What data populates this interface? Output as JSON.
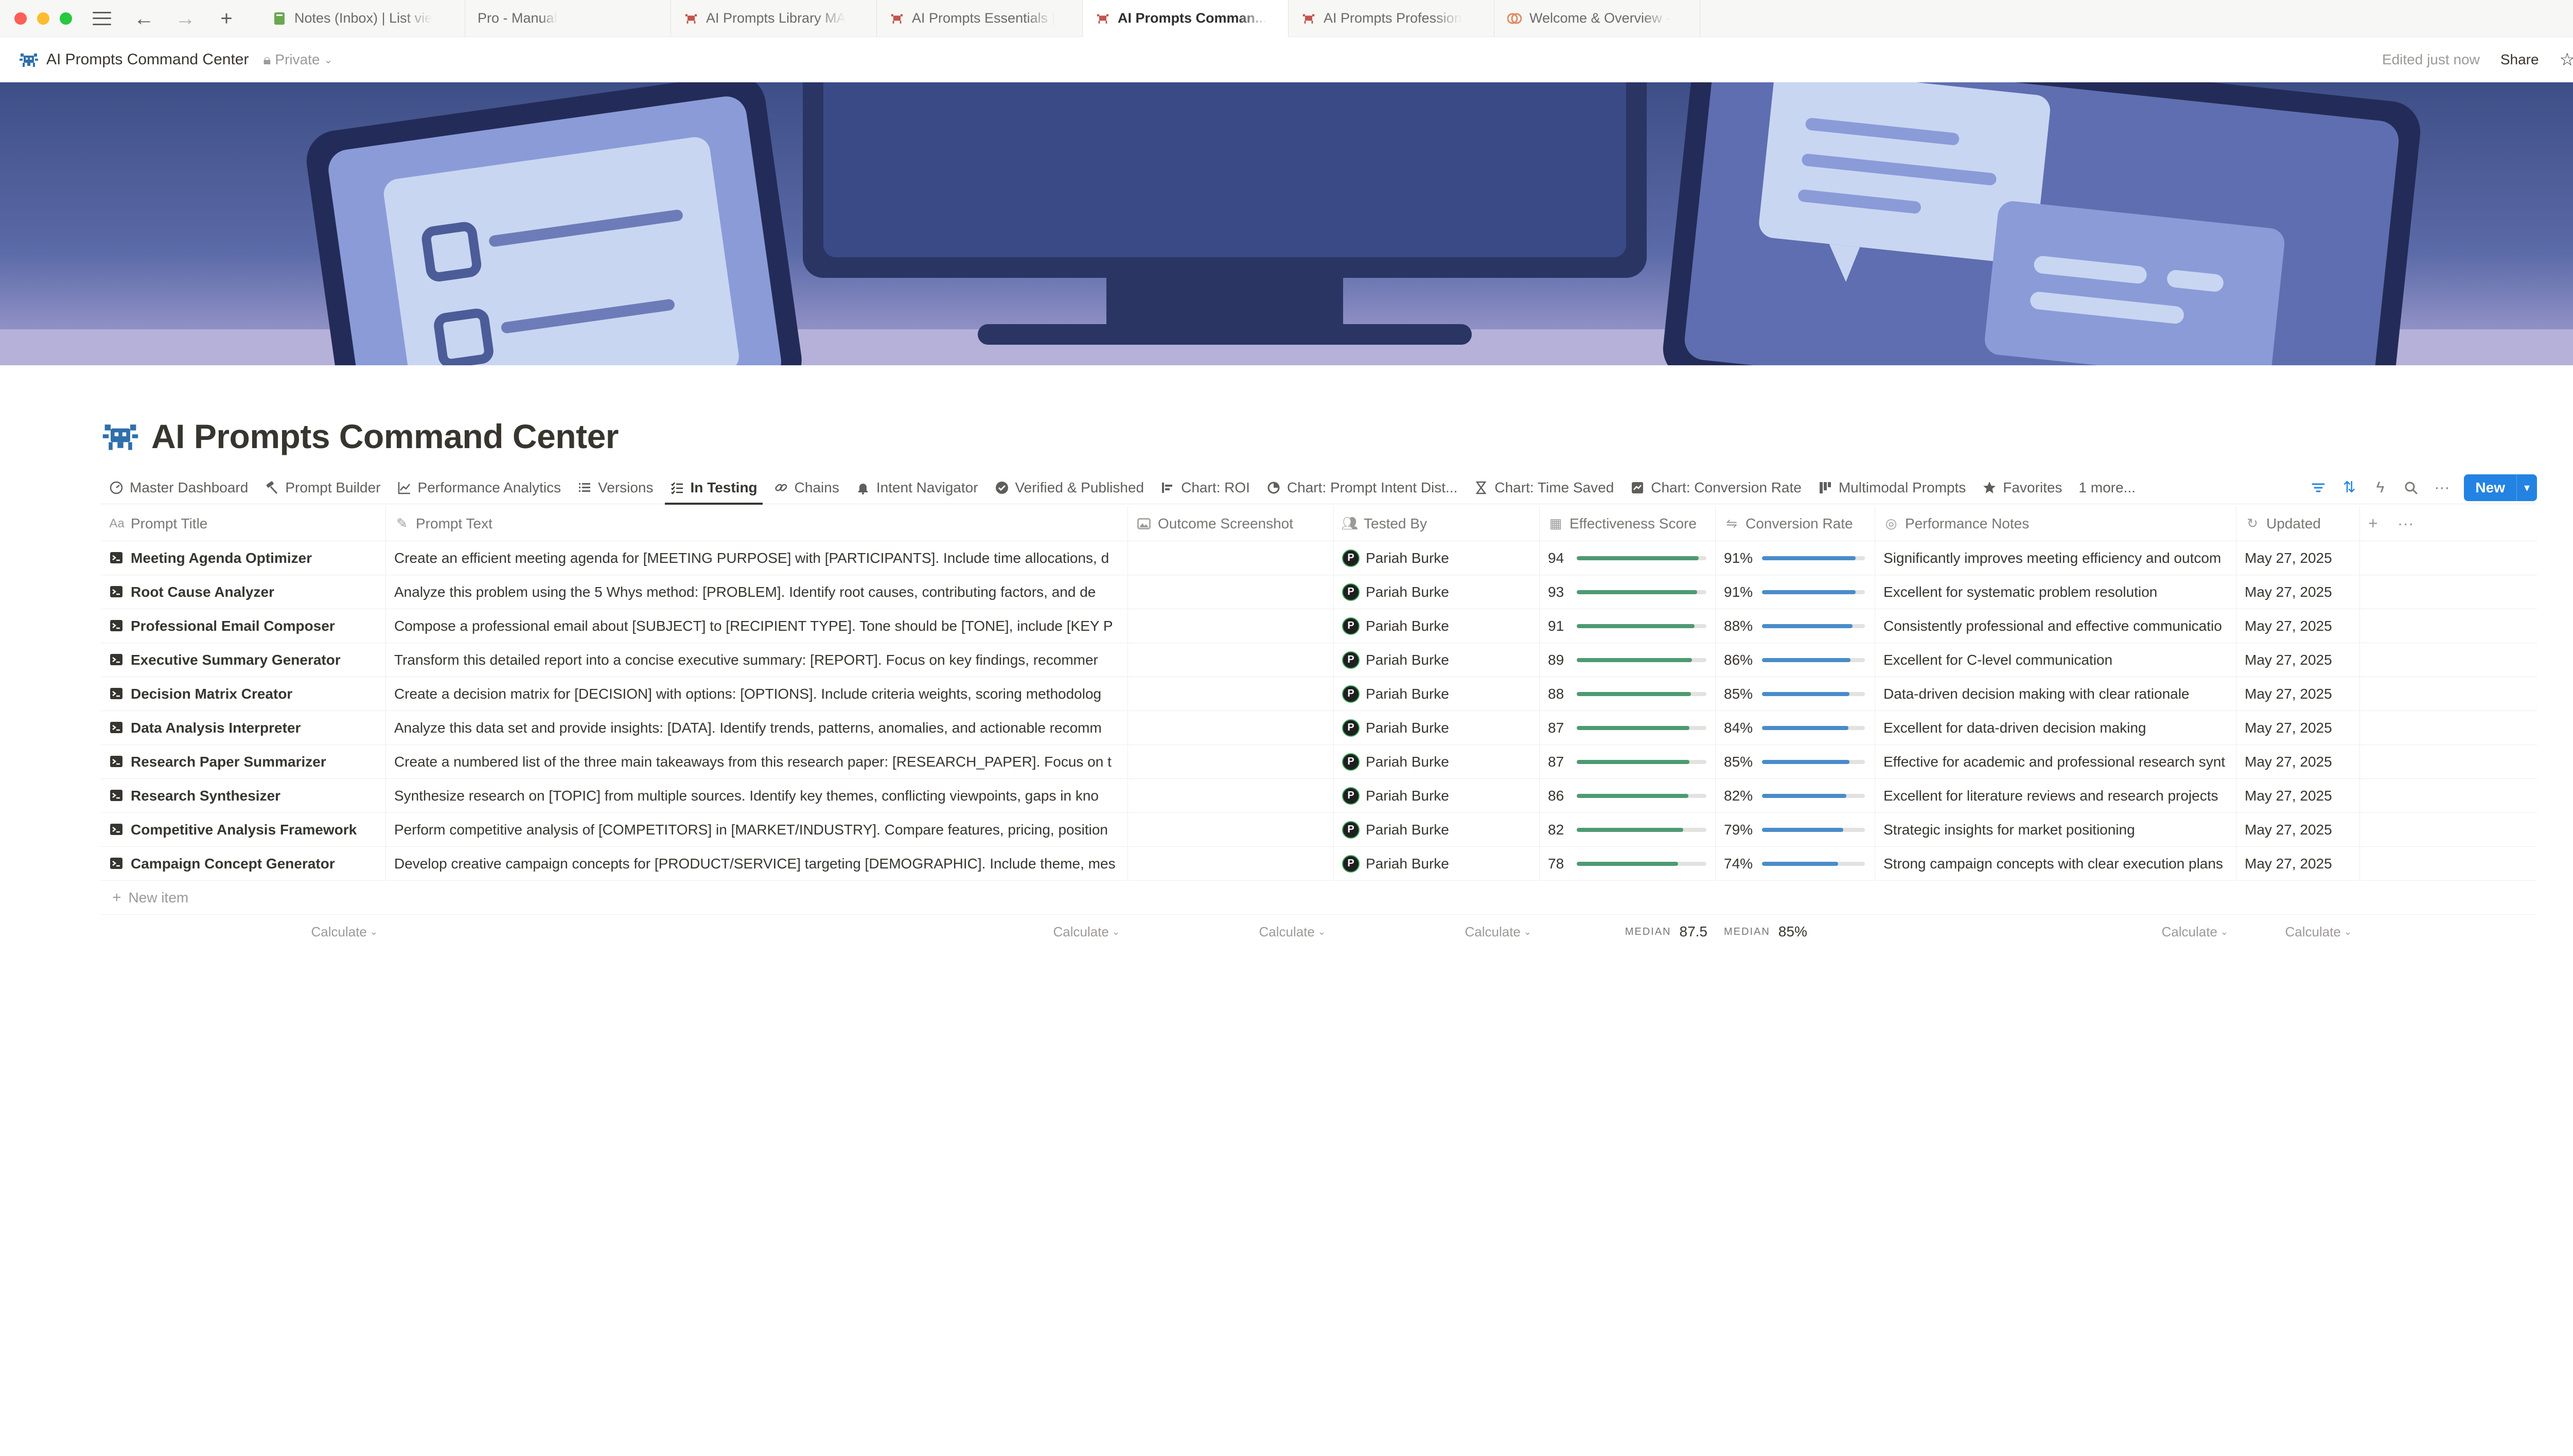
{
  "browser": {
    "tabs": [
      {
        "label": "Notes (Inbox) | List vie",
        "icon": "notebook-icon",
        "active": false
      },
      {
        "label": "Pro - Manual",
        "icon": "none",
        "active": false
      },
      {
        "label": "AI Prompts Library MA",
        "icon": "crab-icon",
        "active": false
      },
      {
        "label": "AI Prompts Essentials |",
        "icon": "crab-icon",
        "active": false
      },
      {
        "label": "AI Prompts Comman...",
        "icon": "crab-icon",
        "active": true
      },
      {
        "label": "AI Prompts Profession",
        "icon": "crab-icon",
        "active": false
      },
      {
        "label": "Welcome & Overview -",
        "icon": "brain-icon",
        "active": false
      }
    ]
  },
  "topbar": {
    "breadcrumb_title": "AI Prompts Command Center",
    "privacy": "Private",
    "edited": "Edited just now",
    "share": "Share"
  },
  "page": {
    "title": "AI Prompts Command Center"
  },
  "views": [
    {
      "label": "Master Dashboard",
      "icon": "gauge-icon"
    },
    {
      "label": "Prompt Builder",
      "icon": "hammer-icon"
    },
    {
      "label": "Performance Analytics",
      "icon": "line-chart-icon"
    },
    {
      "label": "Versions",
      "icon": "list-icon"
    },
    {
      "label": "In Testing",
      "icon": "checklist-icon",
      "active": true
    },
    {
      "label": "Chains",
      "icon": "link-icon"
    },
    {
      "label": "Intent Navigator",
      "icon": "bell-icon"
    },
    {
      "label": "Verified & Published",
      "icon": "verified-icon"
    },
    {
      "label": "Chart: ROI",
      "icon": "bar-chart-icon"
    },
    {
      "label": "Chart: Prompt Intent Dist...",
      "icon": "pie-chart-icon"
    },
    {
      "label": "Chart: Time Saved",
      "icon": "hourglass-icon"
    },
    {
      "label": "Chart: Conversion Rate",
      "icon": "chart-box-icon"
    },
    {
      "label": "Multimodal Prompts",
      "icon": "columns-icon"
    },
    {
      "label": "Favorites",
      "icon": "star-icon"
    }
  ],
  "views_more": "1 more...",
  "new_button": "New",
  "columns": {
    "title": "Prompt Title",
    "text": "Prompt Text",
    "shot": "Outcome Screenshot",
    "tested": "Tested By",
    "eff": "Effectiveness Score",
    "conv": "Conversion Rate",
    "notes": "Performance Notes",
    "updated": "Updated"
  },
  "rows": [
    {
      "title": "Meeting Agenda Optimizer",
      "text": "Create an efficient meeting agenda for [MEETING PURPOSE] with [PARTICIPANTS]. Include time allocations, d",
      "tested_by": "Pariah Burke",
      "effectiveness": 94,
      "conversion": "91%",
      "conversion_value": 91,
      "notes": "Significantly improves meeting efficiency and outcom",
      "updated": "May 27, 2025"
    },
    {
      "title": "Root Cause Analyzer",
      "text": "Analyze this problem using the 5 Whys method: [PROBLEM]. Identify root causes, contributing factors, and de",
      "tested_by": "Pariah Burke",
      "effectiveness": 93,
      "conversion": "91%",
      "conversion_value": 91,
      "notes": "Excellent for systematic problem resolution",
      "updated": "May 27, 2025"
    },
    {
      "title": "Professional Email Composer",
      "text": "Compose a professional email about [SUBJECT] to [RECIPIENT TYPE]. Tone should be [TONE], include [KEY P",
      "tested_by": "Pariah Burke",
      "effectiveness": 91,
      "conversion": "88%",
      "conversion_value": 88,
      "notes": "Consistently professional and effective communicatio",
      "updated": "May 27, 2025"
    },
    {
      "title": "Executive Summary Generator",
      "text": "Transform this detailed report into a concise executive summary: [REPORT]. Focus on key findings, recommer",
      "tested_by": "Pariah Burke",
      "effectiveness": 89,
      "conversion": "86%",
      "conversion_value": 86,
      "notes": "Excellent for C-level communication",
      "updated": "May 27, 2025"
    },
    {
      "title": "Decision Matrix Creator",
      "text": "Create a decision matrix for [DECISION] with options: [OPTIONS]. Include criteria weights, scoring methodolog",
      "tested_by": "Pariah Burke",
      "effectiveness": 88,
      "conversion": "85%",
      "conversion_value": 85,
      "notes": "Data-driven decision making with clear rationale",
      "updated": "May 27, 2025"
    },
    {
      "title": "Data Analysis Interpreter",
      "text": "Analyze this data set and provide insights: [DATA]. Identify trends, patterns, anomalies, and actionable recomm",
      "tested_by": "Pariah Burke",
      "effectiveness": 87,
      "conversion": "84%",
      "conversion_value": 84,
      "notes": "Excellent for data-driven decision making",
      "updated": "May 27, 2025"
    },
    {
      "title": "Research Paper Summarizer",
      "text": "Create a numbered list of the three main takeaways from this research paper: [RESEARCH_PAPER]. Focus on t",
      "tested_by": "Pariah Burke",
      "effectiveness": 87,
      "conversion": "85%",
      "conversion_value": 85,
      "notes": "Effective for academic and professional research synt",
      "updated": "May 27, 2025"
    },
    {
      "title": "Research Synthesizer",
      "text": "Synthesize research on [TOPIC] from multiple sources. Identify key themes, conflicting viewpoints, gaps in kno",
      "tested_by": "Pariah Burke",
      "effectiveness": 86,
      "conversion": "82%",
      "conversion_value": 82,
      "notes": "Excellent for literature reviews and research projects",
      "updated": "May 27, 2025"
    },
    {
      "title": "Competitive Analysis Framework",
      "text": "Perform competitive analysis of [COMPETITORS] in [MARKET/INDUSTRY]. Compare features, pricing, position",
      "tested_by": "Pariah Burke",
      "effectiveness": 82,
      "conversion": "79%",
      "conversion_value": 79,
      "notes": "Strategic insights for market positioning",
      "updated": "May 27, 2025"
    },
    {
      "title": "Campaign Concept Generator",
      "text": "Develop creative campaign concepts for [PRODUCT/SERVICE] targeting [DEMOGRAPHIC]. Include theme, mes",
      "tested_by": "Pariah Burke",
      "effectiveness": 78,
      "conversion": "74%",
      "conversion_value": 74,
      "notes": "Strong campaign concepts with clear execution plans",
      "updated": "May 27, 2025"
    }
  ],
  "new_item": "New item",
  "footer": {
    "calculate": "Calculate",
    "median_label": "MEDIAN",
    "eff_median": "87.5",
    "conv_median": "85%"
  },
  "help": "?",
  "colors": {
    "accent": "#2383e2",
    "score_bar": "#4e9a72",
    "conversion_bar": "#4a8cc9"
  }
}
